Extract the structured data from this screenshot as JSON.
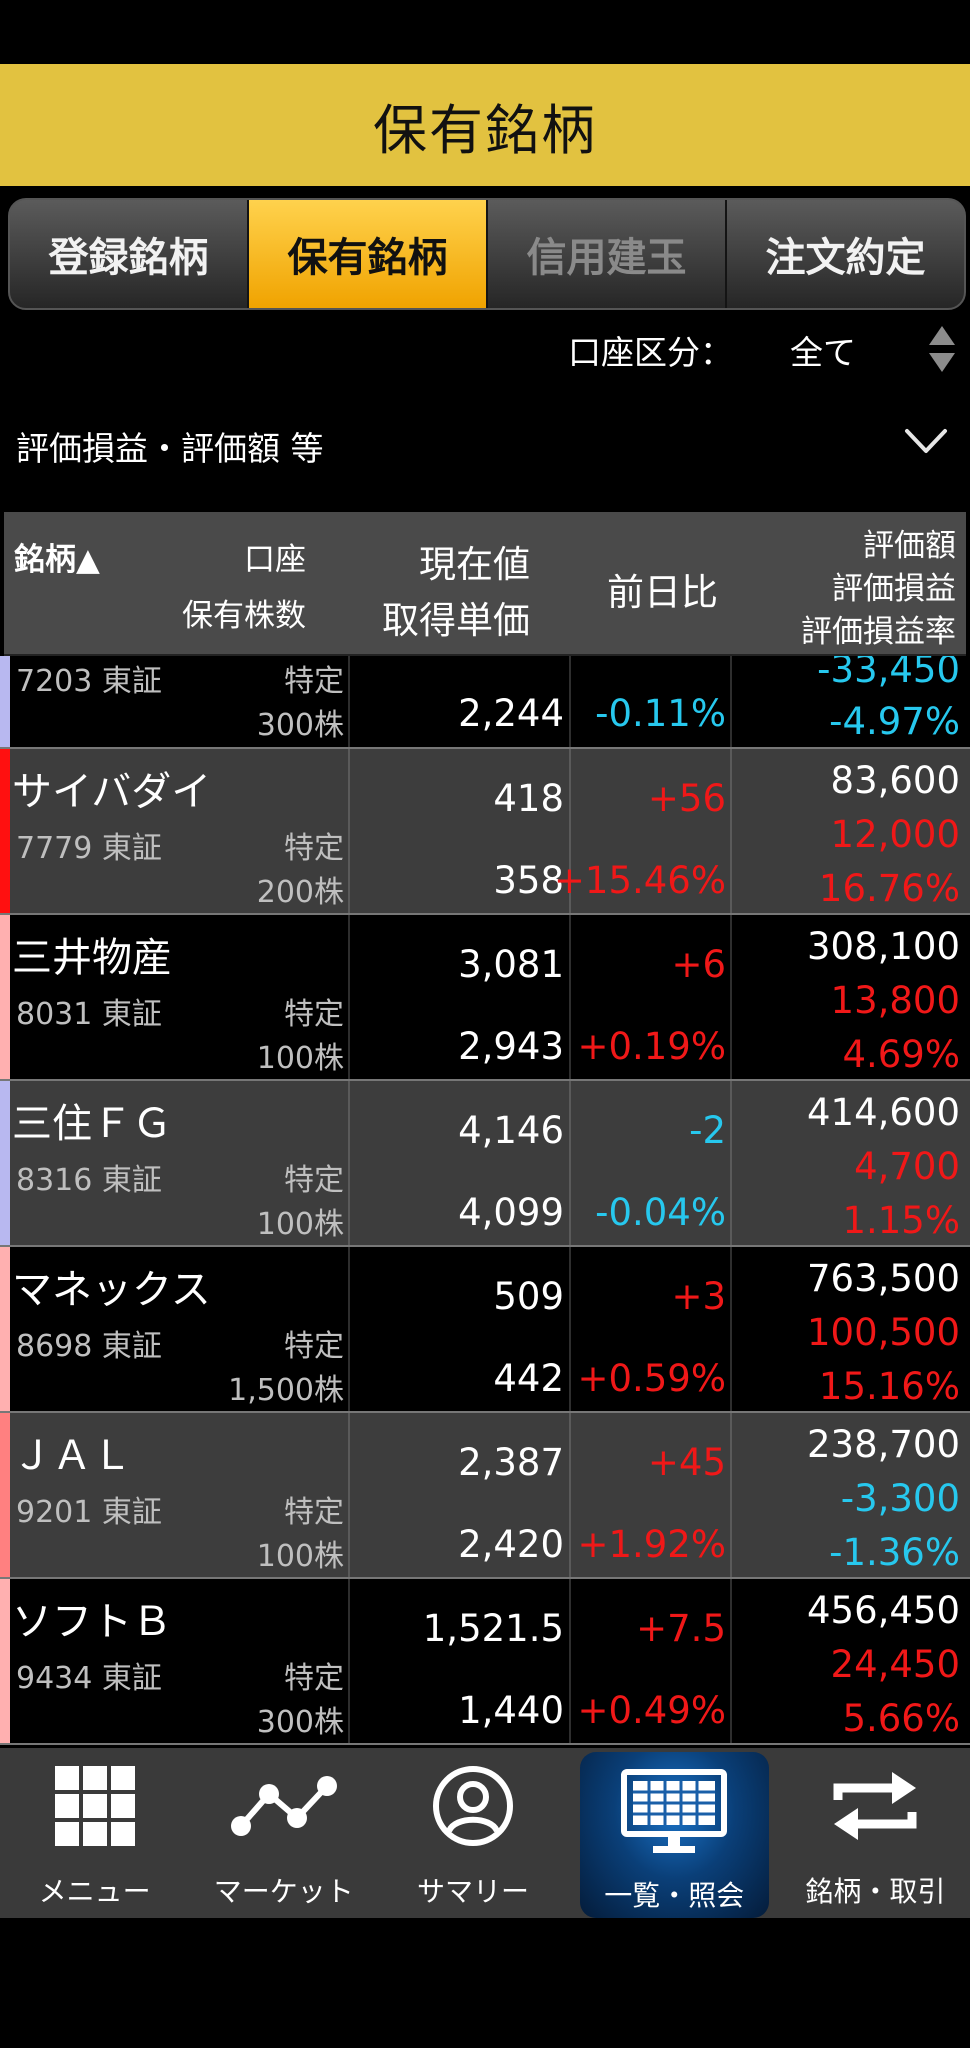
{
  "header": {
    "title": "保有銘柄"
  },
  "tabs": [
    {
      "label": "登録銘柄",
      "state": "normal"
    },
    {
      "label": "保有銘柄",
      "state": "active"
    },
    {
      "label": "信用建玉",
      "state": "disabled"
    },
    {
      "label": "注文約定",
      "state": "normal"
    }
  ],
  "account_filter": {
    "label": "口座区分：",
    "value": "全て"
  },
  "display_selector": {
    "label": "評価損益・評価額 等"
  },
  "columns": {
    "symbol": "銘柄▲",
    "account": "口座",
    "shares": "保有株数",
    "price": "現在値",
    "cost": "取得単価",
    "change": "前日比",
    "market_value": "評価額",
    "pl": "評価損益",
    "pl_rate": "評価損益率"
  },
  "rows": [
    {
      "name": "",
      "code": "7203 東証",
      "account": "特定",
      "shares": "300株",
      "price": "",
      "cost": "2,244",
      "change": "",
      "change_pct": "-0.11%",
      "market_value": "",
      "pl": "-33,450",
      "pl_rate": "-4.97%",
      "marker_color": "#b8b8f0",
      "change_dir": "down",
      "pl_dir": "down"
    },
    {
      "name": "サイバダイ",
      "code": "7779 東証",
      "account": "特定",
      "shares": "200株",
      "price": "418",
      "cost": "358",
      "change": "+56",
      "change_pct": "+15.46%",
      "market_value": "83,600",
      "pl": "12,000",
      "pl_rate": "16.76%",
      "marker_color": "#ff1010",
      "change_dir": "up",
      "pl_dir": "up"
    },
    {
      "name": "三井物産",
      "code": "8031 東証",
      "account": "特定",
      "shares": "100株",
      "price": "3,081",
      "cost": "2,943",
      "change": "+6",
      "change_pct": "+0.19%",
      "market_value": "308,100",
      "pl": "13,800",
      "pl_rate": "4.69%",
      "marker_color": "#ffb0b0",
      "change_dir": "up",
      "pl_dir": "up"
    },
    {
      "name": "三住ＦＧ",
      "code": "8316 東証",
      "account": "特定",
      "shares": "100株",
      "price": "4,146",
      "cost": "4,099",
      "change": "-2",
      "change_pct": "-0.04%",
      "market_value": "414,600",
      "pl": "4,700",
      "pl_rate": "1.15%",
      "marker_color": "#b8b8f0",
      "change_dir": "down",
      "pl_dir": "up"
    },
    {
      "name": "マネックス",
      "code": "8698 東証",
      "account": "特定",
      "shares": "1,500株",
      "price": "509",
      "cost": "442",
      "change": "+3",
      "change_pct": "+0.59%",
      "market_value": "763,500",
      "pl": "100,500",
      "pl_rate": "15.16%",
      "marker_color": "#ffb0b0",
      "change_dir": "up",
      "pl_dir": "up"
    },
    {
      "name": "ＪＡＬ",
      "code": "9201 東証",
      "account": "特定",
      "shares": "100株",
      "price": "2,387",
      "cost": "2,420",
      "change": "+45",
      "change_pct": "+1.92%",
      "market_value": "238,700",
      "pl": "-3,300",
      "pl_rate": "-1.36%",
      "marker_color": "#ff8080",
      "change_dir": "up",
      "pl_dir": "down"
    },
    {
      "name": "ソフトＢ",
      "code": "9434 東証",
      "account": "特定",
      "shares": "300株",
      "price": "1,521.5",
      "cost": "1,440",
      "change": "+7.5",
      "change_pct": "+0.49%",
      "market_value": "456,450",
      "pl": "24,450",
      "pl_rate": "5.66%",
      "marker_color": "#ffb0b0",
      "change_dir": "up",
      "pl_dir": "up"
    }
  ],
  "bottom_nav": [
    {
      "label": "メニュー",
      "icon": "grid-icon"
    },
    {
      "label": "マーケット",
      "icon": "line-chart-icon"
    },
    {
      "label": "サマリー",
      "icon": "user-circle-icon"
    },
    {
      "label": "一覧・照会",
      "icon": "monitor-table-icon",
      "active": true
    },
    {
      "label": "銘柄・取引",
      "icon": "swap-arrows-icon"
    }
  ]
}
